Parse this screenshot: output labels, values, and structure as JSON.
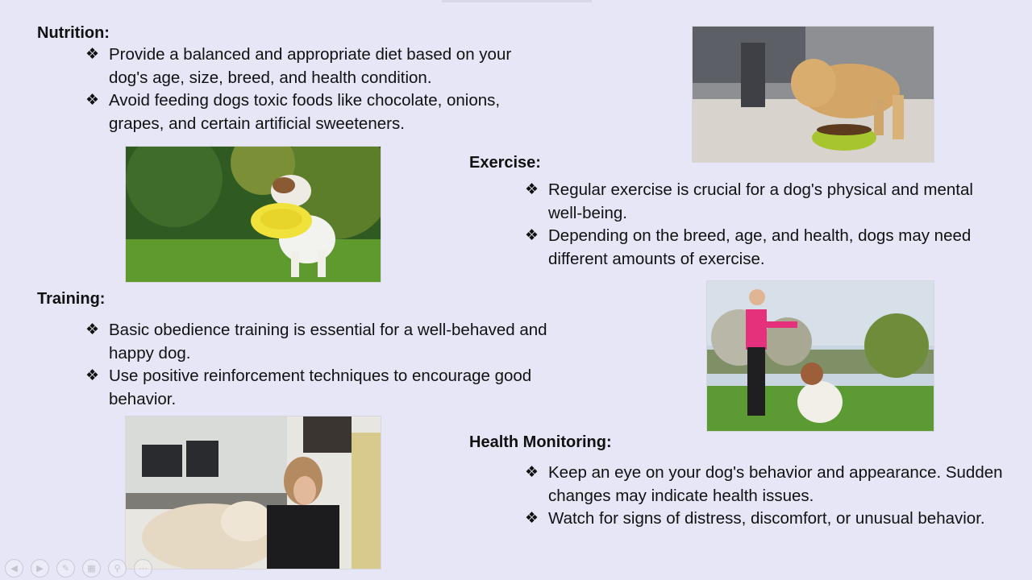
{
  "sections": {
    "nutrition": {
      "title": "Nutrition:",
      "bullets": [
        "Provide a balanced and appropriate diet based on your dog's age, size, breed, and health condition.",
        "Avoid feeding dogs toxic foods like chocolate, onions, grapes, and certain artificial sweeteners."
      ]
    },
    "exercise": {
      "title": "Exercise:",
      "bullets": [
        "Regular exercise is crucial for a dog's physical and mental well-being.",
        "Depending on the breed, age, and health, dogs may need different amounts of exercise."
      ]
    },
    "training": {
      "title": "Training:",
      "bullets": [
        "Basic obedience training is essential for a well-behaved and happy dog.",
        "Use positive reinforcement techniques to encourage good behavior."
      ]
    },
    "health": {
      "title": "Health Monitoring:",
      "bullets": [
        " Keep an eye on your dog's behavior and appearance. Sudden changes may indicate health issues.",
        "Watch for signs of distress, discomfort, or unusual behavior."
      ]
    }
  },
  "bullet_symbol": "❖",
  "toolbar": {
    "icons": [
      "previous-slide-icon",
      "next-slide-icon",
      "pen-icon",
      "slides-grid-icon",
      "zoom-icon",
      "more-options-icon"
    ],
    "glyphs": [
      "◀",
      "▶",
      "✎",
      "▦",
      "⚲",
      "⋯"
    ]
  },
  "colors": {
    "background": "#e6e6f7",
    "text": "#111111"
  }
}
